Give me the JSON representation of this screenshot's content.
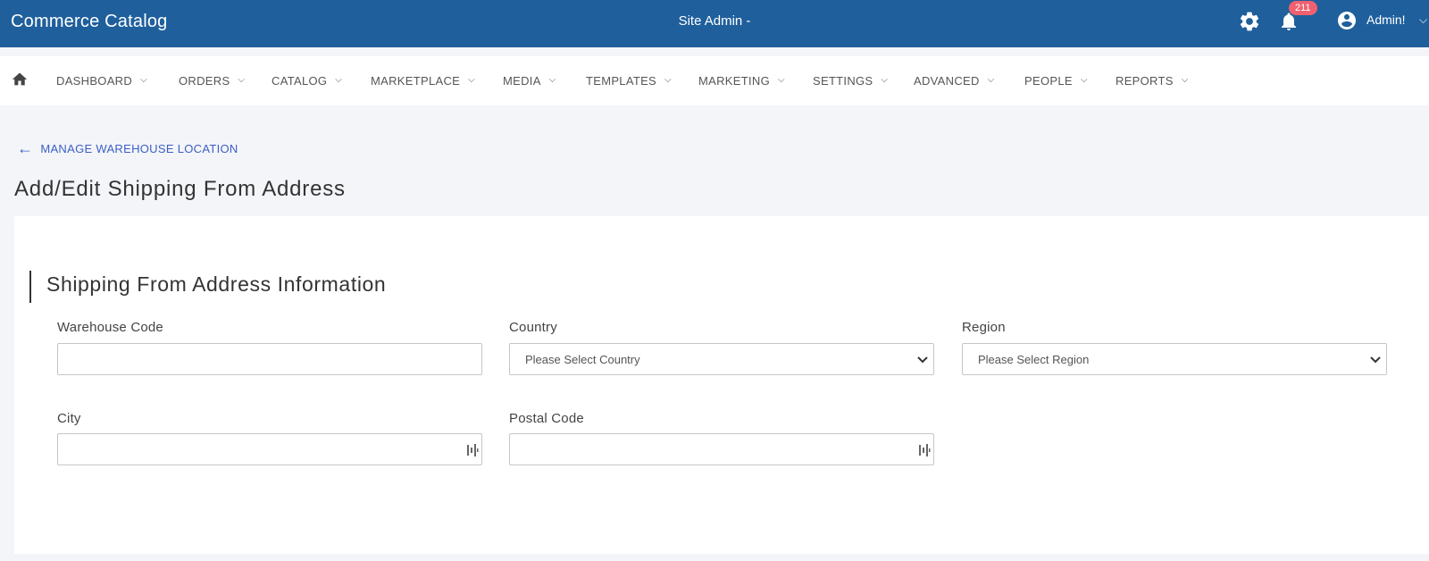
{
  "header": {
    "brand": "Commerce Catalog",
    "site_label": "Site Admin -",
    "notification_count": "211",
    "admin_name": "Admin!"
  },
  "nav": {
    "items": [
      "DASHBOARD",
      "ORDERS",
      "CATALOG",
      "MARKETPLACE",
      "MEDIA",
      "TEMPLATES",
      "MARKETING",
      "SETTINGS",
      "ADVANCED",
      "PEOPLE",
      "REPORTS"
    ]
  },
  "breadcrumb": {
    "back_label": "MANAGE WAREHOUSE LOCATION"
  },
  "page": {
    "title": "Add/Edit Shipping From Address"
  },
  "form": {
    "section_title": "Shipping From Address Information",
    "warehouse_code_label": "Warehouse Code",
    "warehouse_code_value": "",
    "country_label": "Country",
    "country_value": "Please Select Country",
    "region_label": "Region",
    "region_value": "Please Select Region",
    "city_label": "City",
    "city_value": "",
    "postal_code_label": "Postal Code",
    "postal_code_value": ""
  },
  "colors": {
    "header_bg": "#1f5f9c",
    "link": "#3b5fc5",
    "badge": "#f0616f"
  }
}
